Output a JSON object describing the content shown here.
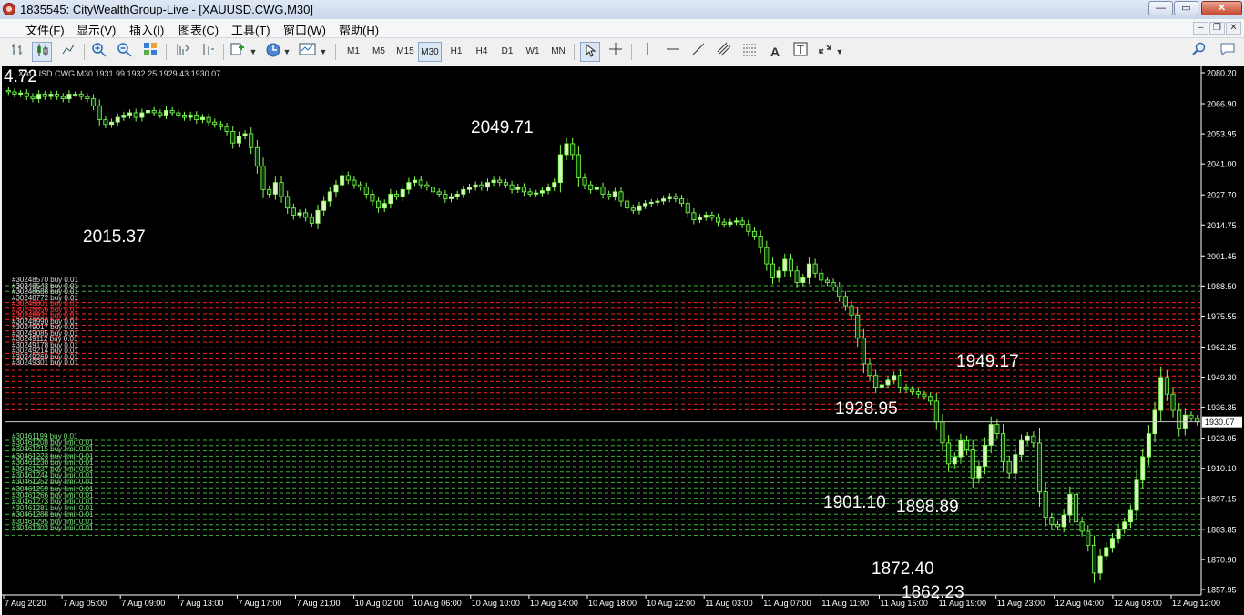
{
  "window": {
    "title": "1835545: CityWealthGroup-Live - [XAUUSD.CWG,M30]"
  },
  "menu": {
    "items": [
      "文件(F)",
      "显示(V)",
      "插入(I)",
      "图表(C)",
      "工具(T)",
      "窗口(W)",
      "帮助(H)"
    ]
  },
  "toolbar": {
    "timeframes": [
      "M1",
      "M5",
      "M15",
      "M30",
      "H1",
      "H4",
      "D1",
      "W1",
      "MN"
    ],
    "active_timeframe": "M30",
    "text_tool_label": "A"
  },
  "chart": {
    "symbol_info": "XAUUSD.CWG,M30  1931.99 1932.25 1929.43 1930.07",
    "left_value": "4.72",
    "annotations": [
      {
        "text": "2049.71",
        "price": 2049.71,
        "bar": 82
      },
      {
        "text": "2015.37",
        "price": 2015.37,
        "bar": 18
      },
      {
        "text": "1928.95",
        "price": 1928.95,
        "bar": 142
      },
      {
        "text": "1901.10",
        "price": 1901.1,
        "bar": 140
      },
      {
        "text": "1898.89",
        "price": 1898.89,
        "bar": 152
      },
      {
        "text": "1872.40",
        "price": 1872.4,
        "bar": 148
      },
      {
        "text": "1862.23",
        "price": 1862.23,
        "bar": 153
      },
      {
        "text": "1949.17",
        "price": 1949.17,
        "bar": 162
      }
    ],
    "price_axis": [
      "2080.20",
      "2066.90",
      "2053.95",
      "2041.00",
      "2027.70",
      "2014.75",
      "2001.45",
      "1988.50",
      "1975.55",
      "1962.25",
      "1949.30",
      "1936.35",
      "1923.05",
      "1910.10",
      "1897.15",
      "1883.85",
      "1870.90",
      "1857.95"
    ],
    "current_price": "1930.07",
    "time_axis": [
      "7 Aug 2020",
      "7 Aug 05:00",
      "7 Aug 09:00",
      "7 Aug 13:00",
      "7 Aug 17:00",
      "7 Aug 21:00",
      "10 Aug 02:00",
      "10 Aug 06:00",
      "10 Aug 10:00",
      "10 Aug 14:00",
      "10 Aug 18:00",
      "10 Aug 22:00",
      "11 Aug 03:00",
      "11 Aug 07:00",
      "11 Aug 11:00",
      "11 Aug 15:00",
      "11 Aug 19:00",
      "11 Aug 23:00",
      "12 Aug 04:00",
      "12 Aug 08:00",
      "12 Aug 12:00"
    ],
    "order_labels_upper": [
      "#30248570 buy 0.01",
      "#30248543 buy 0.01",
      "#30248688 buy 0.01",
      "#30248772 buy 0.01",
      "#30248801 buy 0.01",
      "#30248856 buy 0.01",
      "#30248931 buy 0.01",
      "#30248990 buy 0.01",
      "#30249017 buy 0.01",
      "#30249085 buy 0.01",
      "#30249112 buy 0.01",
      "#30249178 buy 0.01",
      "#30249214 buy 0.01",
      "#30249269 buy 0.01",
      "#30249301 buy 0.01"
    ],
    "order_labels_lower": [
      "#30461199 buy 0.01",
      "#30461208 buy limit 0.01",
      "#30461215 buy limit 0.01",
      "#30461223 buy limit 0.01",
      "#30461230 buy limit 0.01",
      "#30461237 buy limit 0.01",
      "#30461244 buy limit 0.01",
      "#30461252 buy limit 0.01",
      "#30461259 buy limit 0.01",
      "#30461266 buy limit 0.01",
      "#30461273 buy limit 0.01",
      "#30461281 buy limit 0.01",
      "#30461288 buy limit 0.01",
      "#30461295 buy limit 0.01",
      "#30461303 buy limit 0.01"
    ]
  },
  "chart_data": {
    "type": "candlestick",
    "symbol": "XAUUSD.CWG",
    "timeframe": "M30",
    "ylim": [
      1857.95,
      2080.2
    ],
    "candle_close": [
      2072,
      2071,
      2071.5,
      2070,
      2069,
      2071,
      2070,
      2071,
      2070,
      2069,
      2071,
      2071,
      2070,
      2069,
      2066,
      2060,
      2058,
      2059,
      2061,
      2062,
      2063,
      2061,
      2063,
      2064,
      2063,
      2062,
      2064,
      2063,
      2062,
      2061,
      2062,
      2060,
      2061,
      2059,
      2058,
      2057,
      2055,
      2050,
      2053,
      2054,
      2048,
      2040,
      2030,
      2028,
      2033,
      2027,
      2022,
      2019,
      2020,
      2018,
      2015.5,
      2021,
      2025,
      2029,
      2032,
      2036,
      2034,
      2032,
      2031,
      2028,
      2025,
      2022,
      2024,
      2028,
      2027,
      2030,
      2033,
      2034,
      2032,
      2031,
      2029,
      2028,
      2026,
      2027,
      2028,
      2030,
      2031,
      2032,
      2031,
      2033,
      2034,
      2033,
      2032,
      2030,
      2031,
      2029,
      2028,
      2028.5,
      2029.5,
      2031,
      2033,
      2045,
      2049.71,
      2045,
      2035,
      2032,
      2030,
      2031,
      2028,
      2027,
      2029,
      2025,
      2022,
      2021,
      2023,
      2024,
      2024.5,
      2025,
      2026,
      2027,
      2026,
      2024,
      2020,
      2017,
      2018,
      2019,
      2018,
      2016,
      2015,
      2016,
      2016.5,
      2015,
      2012,
      2010,
      2005,
      1998,
      1992,
      1995,
      2000,
      1995,
      1990,
      1992,
      1998,
      1994,
      1991,
      1990,
      1988,
      1984,
      1980,
      1976,
      1966,
      1955,
      1950,
      1945,
      1946,
      1948,
      1950,
      1945,
      1944,
      1943,
      1942,
      1941,
      1939,
      1930,
      1921,
      1912,
      1915,
      1922,
      1918,
      1906,
      1911,
      1920,
      1928.95,
      1925,
      1913,
      1908,
      1916,
      1922,
      1924,
      1921,
      1900,
      1889,
      1886,
      1885,
      1890,
      1898.89,
      1887,
      1883,
      1877,
      1865,
      1872.4,
      1876,
      1880,
      1884,
      1887,
      1892,
      1905,
      1915,
      1925,
      1935,
      1949.17,
      1942,
      1935,
      1927,
      1933,
      1931.5,
      1930.07
    ]
  },
  "colors": {
    "background": "#000000",
    "bull": "#d9f7bd",
    "bear": "#0a3a0a",
    "candle_outline": "#7fff4f",
    "grid_red": "#ff2020",
    "grid_green": "#3cb43c",
    "text": "#ffffff"
  }
}
